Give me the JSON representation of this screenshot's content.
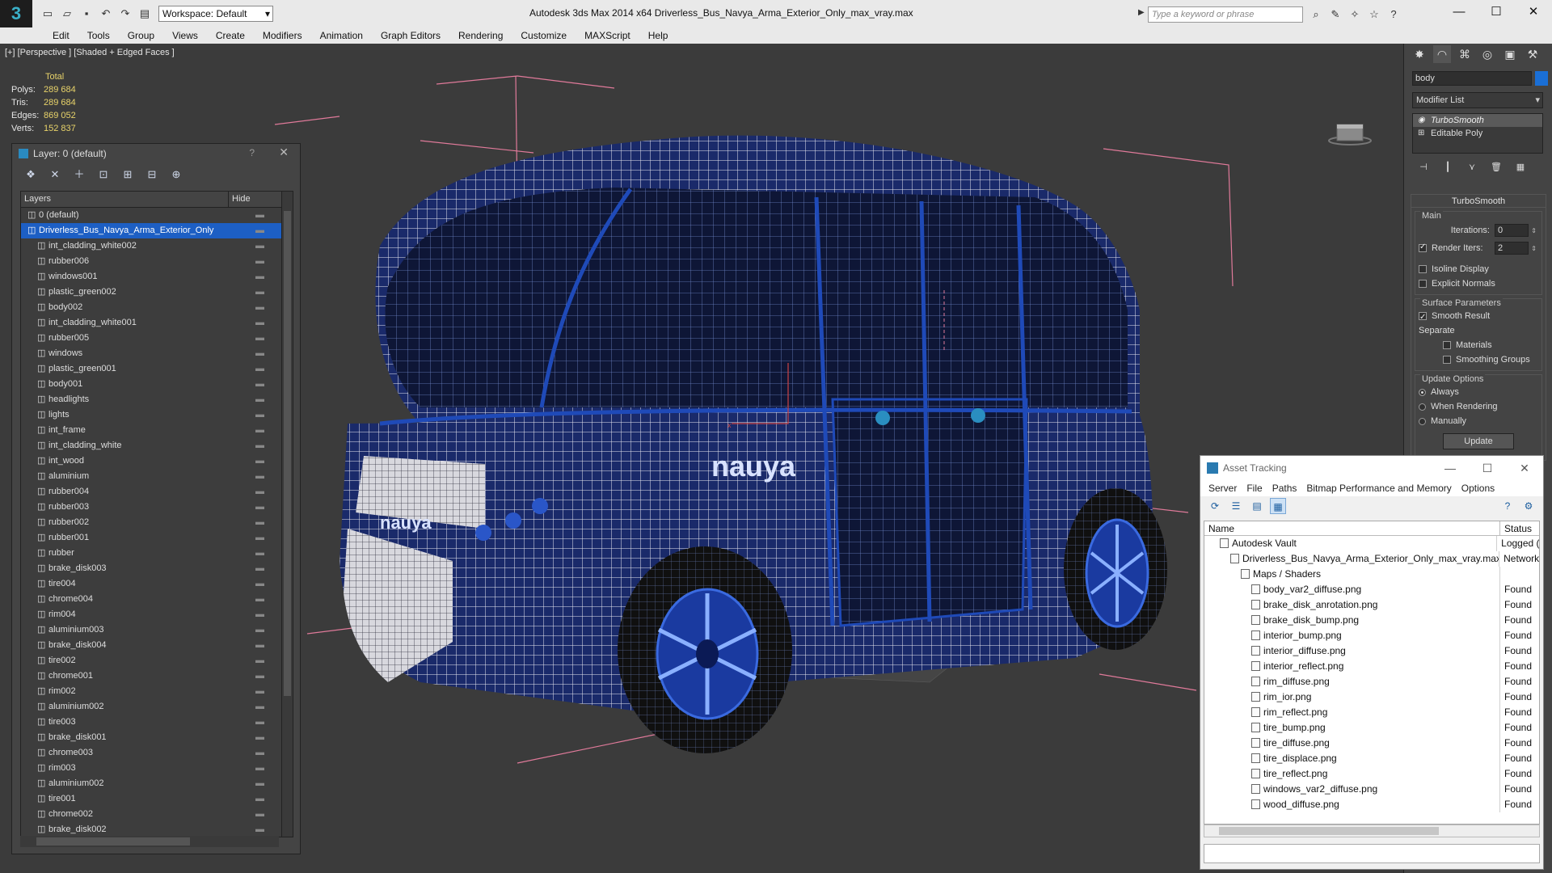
{
  "app": {
    "title": "Autodesk 3ds Max  2014 x64     Driverless_Bus_Navya_Arma_Exterior_Only_max_vray.max",
    "workspace": "Workspace: Default",
    "search_placeholder": "Type a keyword or phrase",
    "menu": [
      "Edit",
      "Tools",
      "Group",
      "Views",
      "Create",
      "Modifiers",
      "Animation",
      "Graph Editors",
      "Rendering",
      "Customize",
      "MAXScript",
      "Help"
    ]
  },
  "viewport": {
    "label": "[+] [Perspective ] [Shaded + Edged Faces ]",
    "stats": {
      "total_label": "Total",
      "rows": [
        {
          "k": "Polys:",
          "v": "289 684"
        },
        {
          "k": "Tris:",
          "v": "289 684"
        },
        {
          "k": "Edges:",
          "v": "869 052"
        },
        {
          "k": "Verts:",
          "v": "152 837"
        }
      ]
    },
    "brand_text": "nauya"
  },
  "layer_panel": {
    "title": "Layer: 0 (default)",
    "help": "?",
    "col_layers": "Layers",
    "col_hide": "Hide",
    "root": "0 (default)",
    "selected": "Driverless_Bus_Navya_Arma_Exterior_Only",
    "items": [
      "int_cladding_white002",
      "rubber006",
      "windows001",
      "plastic_green002",
      "body002",
      "int_cladding_white001",
      "rubber005",
      "windows",
      "plastic_green001",
      "body001",
      "headlights",
      "lights",
      "int_frame",
      "int_cladding_white",
      "int_wood",
      "aluminium",
      "rubber004",
      "rubber003",
      "rubber002",
      "rubber001",
      "rubber",
      "brake_disk003",
      "tire004",
      "chrome004",
      "rim004",
      "aluminium003",
      "brake_disk004",
      "tire002",
      "chrome001",
      "rim002",
      "aluminium002",
      "tire003",
      "brake_disk001",
      "chrome003",
      "rim003",
      "aluminium002",
      "tire001",
      "chrome002",
      "brake_disk002"
    ]
  },
  "command_panel": {
    "object_name": "body",
    "object_color": "#1a6fd6",
    "modifier_list": "Modifier List",
    "stack": [
      "TurboSmooth",
      "Editable Poly"
    ],
    "rollout_title": "TurboSmooth",
    "main_label": "Main",
    "iterations_label": "Iterations:",
    "iterations_value": "0",
    "render_iters_label": "Render Iters:",
    "render_iters_value": "2",
    "isoline": "Isoline Display",
    "explicit_normals": "Explicit Normals",
    "surface_params": "Surface Parameters",
    "smooth_result": "Smooth Result",
    "separate": "Separate",
    "materials": "Materials",
    "smoothing_groups": "Smoothing Groups",
    "update_options": "Update Options",
    "always": "Always",
    "when_rendering": "When Rendering",
    "manually": "Manually",
    "update_btn": "Update"
  },
  "asset_tracking": {
    "title": "Asset Tracking",
    "menu": [
      "Server",
      "File",
      "Paths",
      "Bitmap Performance and Memory",
      "Options"
    ],
    "col_name": "Name",
    "col_status": "Status",
    "rows": [
      {
        "name": "Autodesk Vault",
        "status": "Logged (",
        "indent": 1
      },
      {
        "name": "Driverless_Bus_Navya_Arma_Exterior_Only_max_vray.max",
        "status": "Network",
        "indent": 2
      },
      {
        "name": "Maps / Shaders",
        "status": "",
        "indent": 3
      },
      {
        "name": "body_var2_diffuse.png",
        "status": "Found",
        "indent": 4
      },
      {
        "name": "brake_disk_anrotation.png",
        "status": "Found",
        "indent": 4
      },
      {
        "name": "brake_disk_bump.png",
        "status": "Found",
        "indent": 4
      },
      {
        "name": "interior_bump.png",
        "status": "Found",
        "indent": 4
      },
      {
        "name": "interior_diffuse.png",
        "status": "Found",
        "indent": 4
      },
      {
        "name": "interior_reflect.png",
        "status": "Found",
        "indent": 4
      },
      {
        "name": "rim_diffuse.png",
        "status": "Found",
        "indent": 4
      },
      {
        "name": "rim_ior.png",
        "status": "Found",
        "indent": 4
      },
      {
        "name": "rim_reflect.png",
        "status": "Found",
        "indent": 4
      },
      {
        "name": "tire_bump.png",
        "status": "Found",
        "indent": 4
      },
      {
        "name": "tire_diffuse.png",
        "status": "Found",
        "indent": 4
      },
      {
        "name": "tire_displace.png",
        "status": "Found",
        "indent": 4
      },
      {
        "name": "tire_reflect.png",
        "status": "Found",
        "indent": 4
      },
      {
        "name": "windows_var2_diffuse.png",
        "status": "Found",
        "indent": 4
      },
      {
        "name": "wood_diffuse.png",
        "status": "Found",
        "indent": 4
      }
    ]
  }
}
